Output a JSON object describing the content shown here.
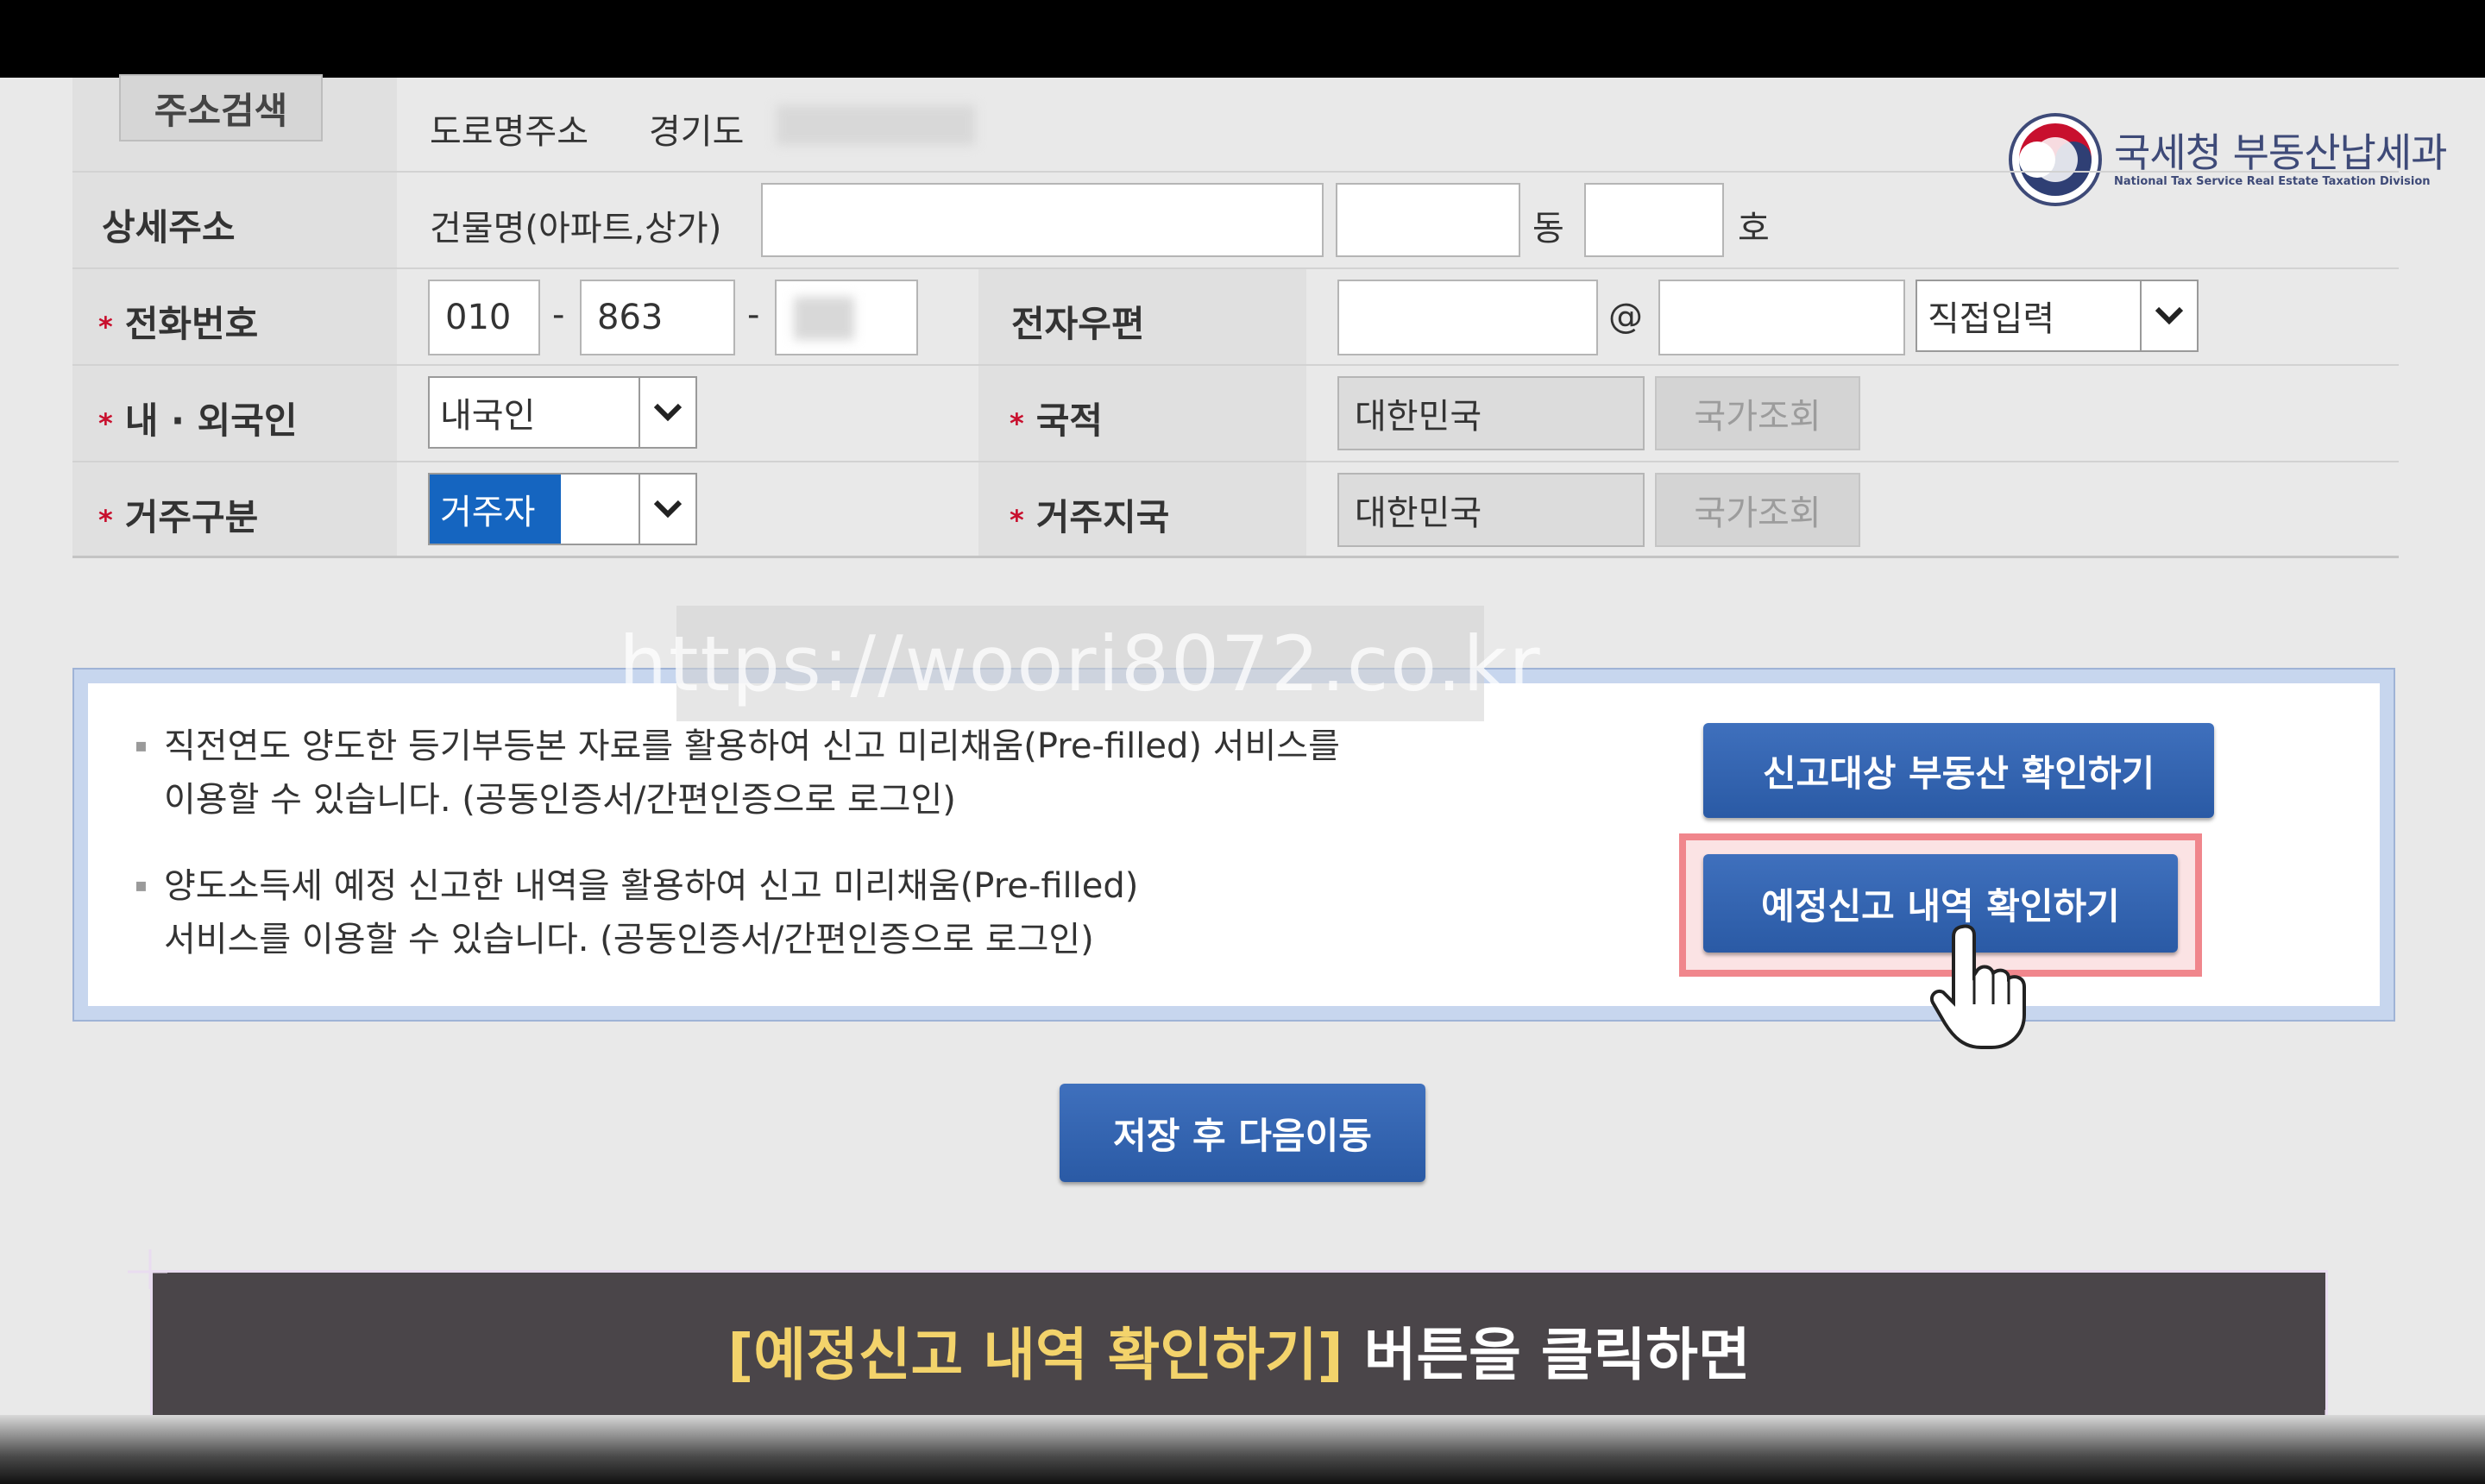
{
  "logo": {
    "korean": "국세청 부동산납세과",
    "english": "National Tax Service Real Estate Taxation Division"
  },
  "address": {
    "search_button": "주소검색",
    "road_address_label": "도로명주소",
    "province": "경기도"
  },
  "detail_address": {
    "label": "상세주소",
    "building_label": "건물명(아파트,상가)",
    "dong_label": "동",
    "ho_label": "호"
  },
  "phone": {
    "label": "전화번호",
    "part1": "010",
    "part2": "863",
    "separator": "-"
  },
  "email": {
    "label": "전자우편",
    "at": "@",
    "domain_select": "직접입력"
  },
  "resident_type": {
    "label": "내 · 외국인",
    "value": "내국인"
  },
  "nationality": {
    "label": "국적",
    "value": "대한민국",
    "lookup_button": "국가조회"
  },
  "residency": {
    "label": "거주구분",
    "value": "거주자"
  },
  "residence_country": {
    "label": "거주지국",
    "value": "대한민국",
    "lookup_button": "국가조회"
  },
  "watermark": "https://woori8072.co.kr",
  "info": {
    "bullet1_line1": "직전연도 양도한 등기부등본 자료를 활용하여 신고 미리채움(Pre-filled) 서비스를",
    "bullet1_line2": "이용할 수 있습니다. (공동인증서/간편인증으로 로그인)",
    "bullet2_line1": "양도소득세 예정 신고한 내역을 활용하여 신고 미리채움(Pre-filled)",
    "bullet2_line2": "서비스를 이용할 수 있습니다. (공동인증서/간편인증으로 로그인)",
    "button1": "신고대상 부동산 확인하기",
    "button2": "예정신고 내역 확인하기"
  },
  "save_button": "저장 후 다음이동",
  "subtitle": {
    "highlight": "[예정신고 내역 확인하기]",
    "rest": "버튼을 클릭하면"
  },
  "colors": {
    "primary_button": "#2f60ab",
    "highlight_frame": "#f0868c",
    "required_star": "#c8102e",
    "subtitle_highlight": "#f3d36b"
  }
}
